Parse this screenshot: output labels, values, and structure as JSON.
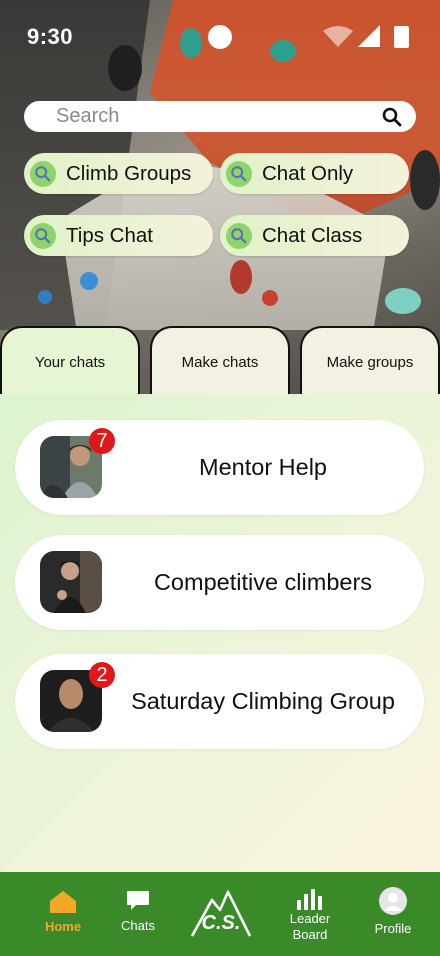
{
  "status_bar": {
    "time": "9:30"
  },
  "search": {
    "placeholder": "Search"
  },
  "chips": [
    {
      "label": "Climb Groups"
    },
    {
      "label": "Chat Only"
    },
    {
      "label": "Tips Chat"
    },
    {
      "label": "Chat Class"
    }
  ],
  "tabs": [
    {
      "label": "Your chats",
      "active": true
    },
    {
      "label": "Make chats",
      "active": false
    },
    {
      "label": "Make groups",
      "active": false
    }
  ],
  "chats": [
    {
      "title": "Mentor Help",
      "unread": "7"
    },
    {
      "title": "Competitive climbers",
      "unread": null
    },
    {
      "title": "Saturday Climbing Group",
      "unread": "2"
    }
  ],
  "nav": {
    "home": "Home",
    "chats": "Chats",
    "logo": "C.S.",
    "leaderboard_line1": "Leader",
    "leaderboard_line2": "Board",
    "profile": "Profile"
  },
  "colors": {
    "nav_background": "#3a8a2a",
    "nav_active": "#f2a925",
    "badge": "#e01818",
    "chip_icon": "#8fd46a"
  }
}
